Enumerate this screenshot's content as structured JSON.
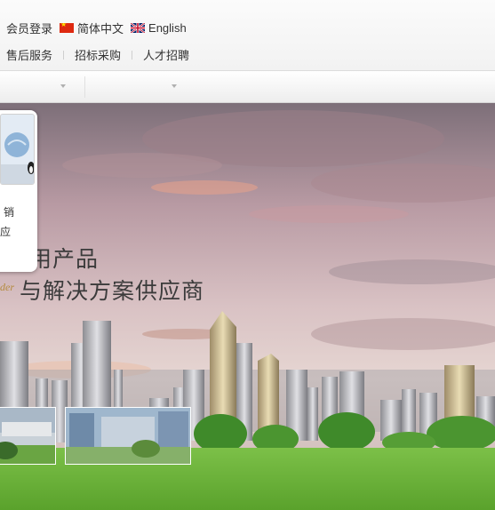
{
  "header": {
    "member_login": "会员登录",
    "lang_cn": "简体中文",
    "lang_en": "English",
    "nav": [
      {
        "label": "售后服务"
      },
      {
        "label": "招标采购"
      },
      {
        "label": "人才招聘"
      }
    ]
  },
  "banner": {
    "tagline_line1": "用产品",
    "tagline_line2": "与解决方案供应商",
    "tagline_en_fragment": "der"
  },
  "popup": {
    "text_line1": "销",
    "text_line2": "应"
  },
  "colors": {
    "sky_top": "#7f6f7a",
    "sky_mid": "#c7a9b0",
    "grass": "#6fb23b",
    "tagline": "#3b3b3b",
    "tagline_en": "#b48a3c"
  },
  "icons": [
    "china-flag-icon",
    "uk-flag-icon",
    "chevron-down-icon"
  ]
}
